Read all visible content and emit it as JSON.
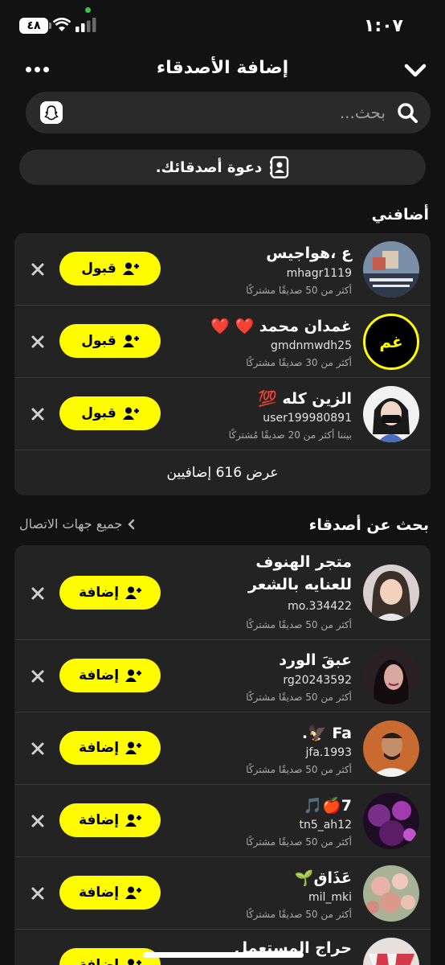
{
  "status_bar": {
    "time": "١:٠٧",
    "battery": "٤٨"
  },
  "header": {
    "title": "إضافة الأصدقاء"
  },
  "search": {
    "placeholder": "بحث..."
  },
  "invite": {
    "label": "دعوة أصدقائك."
  },
  "added_me": {
    "title": "أضافني",
    "action_label": "قبول",
    "items": [
      {
        "name": "ع ،هواجيس",
        "username": "mhagr1119",
        "mutual": "أكثر من 50 صديقًا مشتركًا"
      },
      {
        "name": "غمدان محمد ❤️ ❤️",
        "username": "gmdnmwdh25",
        "mutual": "أكثر من 30 صديقًا مشتركًا",
        "initials": "غم"
      },
      {
        "name": "الزين كله 💯",
        "username": "user199980891",
        "mutual": "بيننا أكثر من 20 صديقًا مُشتركًا"
      }
    ],
    "view_more": "عرض 616 إضافيين"
  },
  "find_friends": {
    "title": "بحث عن أصدقاء",
    "see_all": "جميع جهات الاتصال",
    "action_label": "إضافة",
    "items": [
      {
        "name_line1": "متجر الهنوف",
        "name_line2": "للعنايه بالشعر",
        "username": "mo.334422",
        "mutual": "أكثر من 50 صديقًا مشتركًا"
      },
      {
        "name": "عبقَ الورد",
        "username": "rg20243592",
        "mutual": "أكثر من 50 صديقًا مشتركًا"
      },
      {
        "name": "Fa 🦅.",
        "username": "jfa.1993",
        "mutual": "أكثر من 50 صديقًا مشتركًا"
      },
      {
        "name": "7🍎🎵",
        "username": "tn5_ah12",
        "mutual": "أكثر من 50 صديقًا مشتركًا"
      },
      {
        "name": "عَذَاق🌱",
        "username": "mil_mki",
        "mutual": "أكثر من 50 صديقًا مشتركًا"
      },
      {
        "name": "حراج المستعمل",
        "username": "",
        "mutual": ""
      }
    ]
  },
  "colors": {
    "accent": "#fffc00",
    "background": "#121212",
    "card": "#232323"
  }
}
